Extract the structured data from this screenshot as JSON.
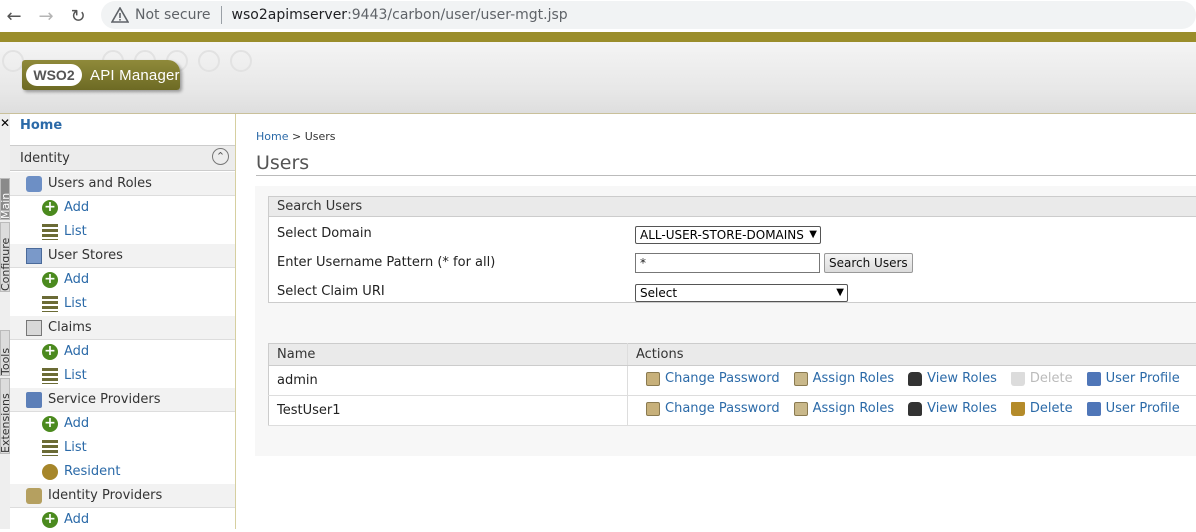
{
  "browser": {
    "security_label": "Not secure",
    "url_host": "wso2apimserver",
    "url_path": ":9443/carbon/user/user-mgt.jsp"
  },
  "header": {
    "logo_brand": "WSO2",
    "product": "API Manager"
  },
  "vtabs": [
    "Main",
    "Configure",
    "Tools",
    "Extensions"
  ],
  "sidebar": {
    "home": "Home",
    "section_title": "Identity",
    "items": [
      {
        "kind": "section",
        "icon": "users-roles-icon",
        "label": "Users and Roles"
      },
      {
        "kind": "sub",
        "icon": "add-icon",
        "label": "Add"
      },
      {
        "kind": "sub",
        "icon": "list-icon",
        "label": "List"
      },
      {
        "kind": "section",
        "icon": "user-stores-icon",
        "label": "User Stores"
      },
      {
        "kind": "sub",
        "icon": "add-icon",
        "label": "Add"
      },
      {
        "kind": "sub",
        "icon": "list-icon",
        "label": "List"
      },
      {
        "kind": "section",
        "icon": "claims-icon",
        "label": "Claims"
      },
      {
        "kind": "sub",
        "icon": "add-icon",
        "label": "Add"
      },
      {
        "kind": "sub",
        "icon": "list-icon",
        "label": "List"
      },
      {
        "kind": "section",
        "icon": "service-providers-icon",
        "label": "Service Providers"
      },
      {
        "kind": "sub",
        "icon": "add-icon",
        "label": "Add"
      },
      {
        "kind": "sub",
        "icon": "list-icon",
        "label": "List"
      },
      {
        "kind": "sub",
        "icon": "resident-icon",
        "label": "Resident"
      },
      {
        "kind": "section",
        "icon": "identity-providers-icon",
        "label": "Identity Providers"
      },
      {
        "kind": "sub",
        "icon": "add-icon",
        "label": "Add"
      }
    ]
  },
  "main": {
    "breadcrumb": {
      "home": "Home",
      "sep": " > ",
      "current": "Users"
    },
    "title": "Users",
    "search": {
      "heading": "Search Users",
      "domain_label": "Select Domain",
      "domain_value": "ALL-USER-STORE-DOMAINS",
      "pattern_label": "Enter Username Pattern (* for all)",
      "pattern_value": "*",
      "search_button": "Search Users",
      "claim_label": "Select Claim URI",
      "claim_value": "Select"
    },
    "table": {
      "columns": [
        "Name",
        "Actions"
      ],
      "rows": [
        {
          "name": "admin",
          "delete_enabled": false
        },
        {
          "name": "TestUser1",
          "delete_enabled": true
        }
      ],
      "actions": {
        "change_password": "Change Password",
        "assign_roles": "Assign Roles",
        "view_roles": "View Roles",
        "delete": "Delete",
        "user_profile": "User Profile"
      }
    }
  },
  "colors": {
    "link": "#2b6aa8",
    "brand_olive": "#9a8d2b"
  }
}
